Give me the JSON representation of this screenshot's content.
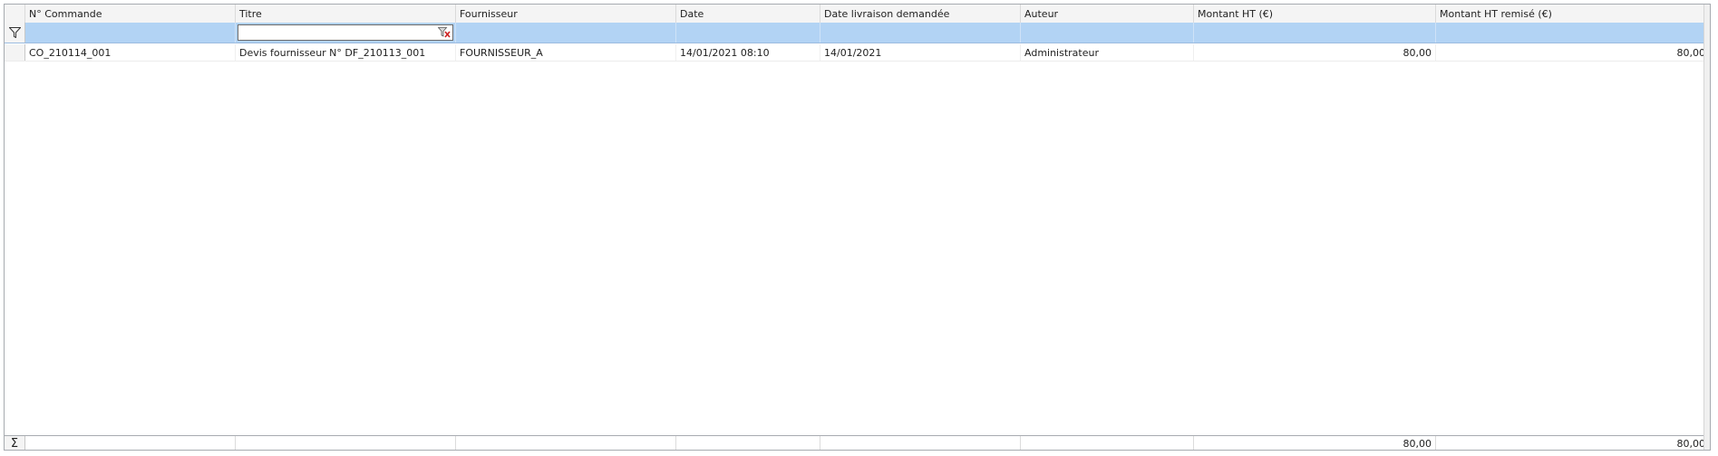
{
  "columns": [
    {
      "key": "num",
      "label": "N° Commande"
    },
    {
      "key": "titre",
      "label": "Titre"
    },
    {
      "key": "fournisseur",
      "label": "Fournisseur"
    },
    {
      "key": "date",
      "label": "Date"
    },
    {
      "key": "date_livraison",
      "label": "Date livraison demandée"
    },
    {
      "key": "auteur",
      "label": "Auteur"
    },
    {
      "key": "montant_ht",
      "label": "Montant HT (€)"
    },
    {
      "key": "montant_ht_remise",
      "label": "Montant HT remisé (€)"
    }
  ],
  "filter": {
    "titre_value": "",
    "icon": "funnel-icon",
    "clear_icon": "clear-filter-icon"
  },
  "rows": [
    {
      "num": "CO_210114_001",
      "titre": "Devis fournisseur N° DF_210113_001",
      "fournisseur": "FOURNISSEUR_A",
      "date": "14/01/2021 08:10",
      "date_livraison": "14/01/2021",
      "auteur": "Administrateur",
      "montant_ht": "80,00",
      "montant_ht_remise": "80,00"
    }
  ],
  "summary": {
    "symbol": "Σ",
    "montant_ht": "80,00",
    "montant_ht_remise": "80,00"
  },
  "colors": {
    "filter_row": "#b2d3f4",
    "header": "#f4f4f4",
    "border": "#a7abb0"
  }
}
